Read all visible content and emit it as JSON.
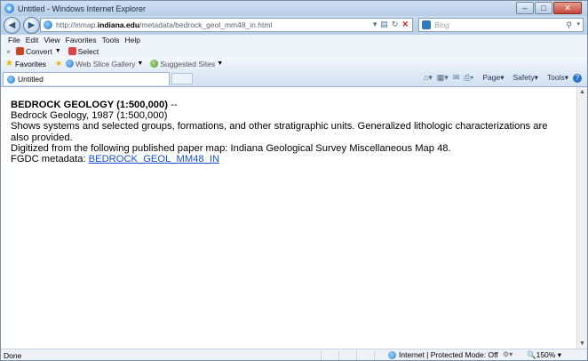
{
  "window": {
    "title": "Untitled - Windows Internet Explorer",
    "controls": [
      "–",
      "□",
      "✕"
    ]
  },
  "address": {
    "url_prefix": "http://inmap.",
    "url_domain": "indiana.edu",
    "url_path": "/metadata/bedrock_geol_mm48_in.html",
    "search_placeholder": "Bing"
  },
  "menu": [
    "File",
    "Edit",
    "View",
    "Favorites",
    "Tools",
    "Help"
  ],
  "toolbar": {
    "close": "×",
    "convert_label": "Convert",
    "select_label": "Select"
  },
  "favorites": {
    "label": "Favorites",
    "web_slice_gallery": "Web Slice Gallery",
    "suggested_sites": "Suggested Sites"
  },
  "tab": {
    "title": "Untitled"
  },
  "commands": {
    "page": "Page",
    "safety": "Safety",
    "tools": "Tools"
  },
  "document": {
    "title": "BEDROCK GEOLOGY (1:500,000)",
    "title_suffix": " --",
    "line1": "Bedrock Geology, 1987 (1:500,000)",
    "line2": "Shows systems and selected groups, formations, and other stratigraphic units. Generalized lithologic characterizations are also provided.",
    "line3": "Digitized from the following published paper map: Indiana Geological Survey Miscellaneous Map 48.",
    "fgdc_label": "FGDC metadata: ",
    "fgdc_link": "BEDROCK_GEOL_MM48_IN"
  },
  "status": {
    "left": "Done",
    "zone": "Internet | Protected Mode: Off",
    "zoom": "150%"
  }
}
